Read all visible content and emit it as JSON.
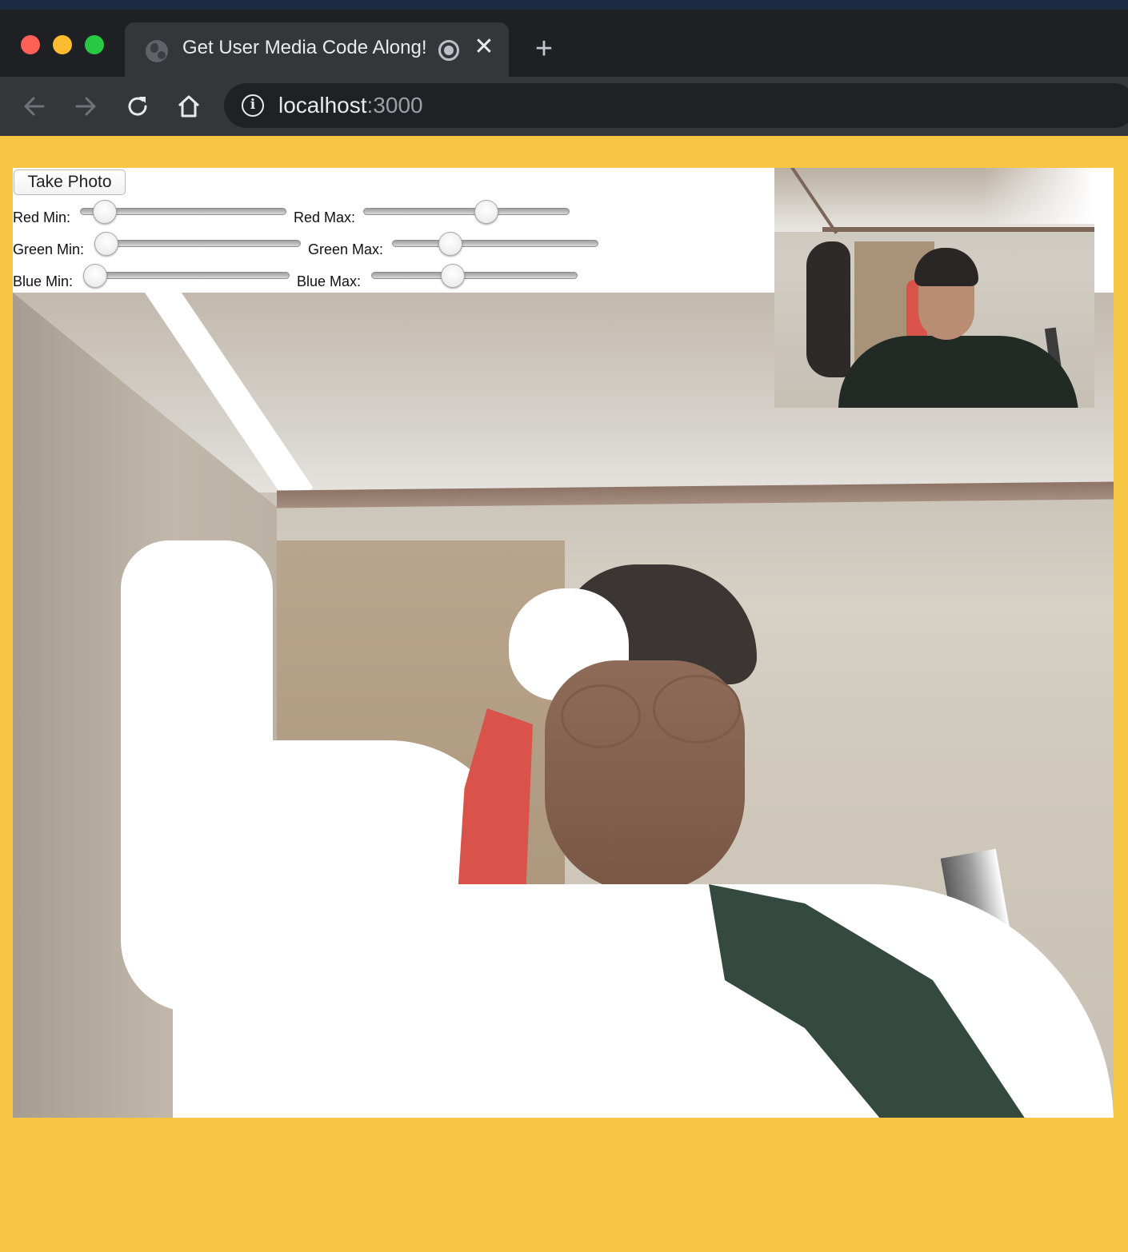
{
  "browser": {
    "tab_title": "Get User Media Code Along!",
    "tab_close": "✕",
    "new_tab": "+",
    "url_host": "localhost",
    "url_port": ":3000",
    "info_icon": "i"
  },
  "controls": {
    "take_photo_label": "Take Photo",
    "sliders": {
      "red_min": {
        "label": "Red Min:",
        "value": 0
      },
      "red_max": {
        "label": "Red Max:",
        "value": 0.6
      },
      "green_min": {
        "label": "Green Min:",
        "value": 0
      },
      "green_max": {
        "label": "Green Max:",
        "value": 0.3
      },
      "blue_min": {
        "label": "Blue Min:",
        "value": 0
      },
      "blue_max": {
        "label": "Blue Max:",
        "value": 0.4
      }
    }
  },
  "colors": {
    "page_background": "#f7c744",
    "browser_chrome": "#35363a",
    "shirt_green": "#344a3e",
    "red_item": "#d9534a"
  },
  "icons": {
    "back": "arrow-left-icon",
    "forward": "arrow-right-icon",
    "reload": "reload-icon",
    "home": "home-icon",
    "info": "info-icon",
    "favicon": "globe-icon",
    "recording": "recording-icon",
    "close": "close-icon",
    "new_tab": "plus-icon"
  }
}
